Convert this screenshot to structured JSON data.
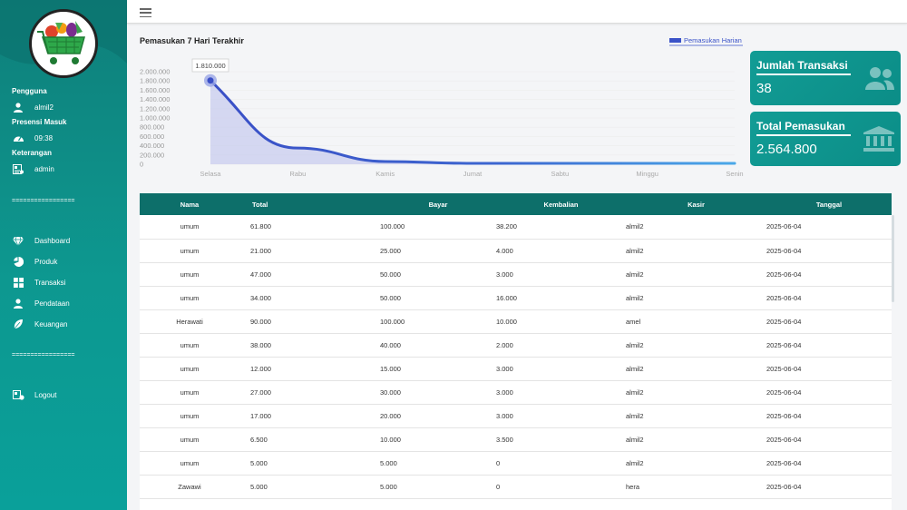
{
  "sidebar": {
    "pengguna_title": "Pengguna",
    "pengguna_value": "almil2",
    "presensi_title": "Presensi Masuk",
    "presensi_value": "09:38",
    "keterangan_title": "Keterangan",
    "keterangan_value": "admin",
    "divider": "=================",
    "menu": [
      {
        "label": "Dashboard",
        "icon": "gem-icon"
      },
      {
        "label": "Produk",
        "icon": "pie-icon"
      },
      {
        "label": "Transaksi",
        "icon": "grid-icon"
      },
      {
        "label": "Pendataan",
        "icon": "user-icon"
      },
      {
        "label": "Keuangan",
        "icon": "leaf-icon"
      }
    ],
    "logout": "Logout"
  },
  "chart": {
    "title": "Pemasukan 7 Hari Terakhir",
    "legend": "Pemasukan Harian",
    "tooltip": "1.810.000"
  },
  "chart_data": {
    "type": "area",
    "categories": [
      "Selasa",
      "Rabu",
      "Kamis",
      "Jumat",
      "Sabtu",
      "Minggu",
      "Senin"
    ],
    "series": [
      {
        "name": "Pemasukan Harian",
        "values": [
          1810000,
          350000,
          60000,
          20000,
          20000,
          20000,
          20000
        ]
      }
    ],
    "ylim": [
      0,
      2000000
    ],
    "yticks": [
      "0",
      "200.000",
      "400.000",
      "600.000",
      "800.000",
      "1.000.000",
      "1.200.000",
      "1.400.000",
      "1.600.000",
      "1.800.000",
      "2.000.000"
    ],
    "grid": true,
    "legend_position": "top-right",
    "colors": {
      "line": "#3a52c8",
      "fill": "#c6cbee"
    }
  },
  "cards": [
    {
      "title": "Jumlah Transaksi",
      "value": "38",
      "icon": "users-icon"
    },
    {
      "title": "Total Pemasukan",
      "value": "2.564.800",
      "icon": "bank-icon"
    }
  ],
  "table": {
    "headers": [
      "Nama",
      "Total",
      "Bayar",
      "Kembalian",
      "Kasir",
      "Tanggal"
    ],
    "rows": [
      [
        "umum",
        "61.800",
        "100.000",
        "38.200",
        "almil2",
        "2025-06-04"
      ],
      [
        "umum",
        "21.000",
        "25.000",
        "4.000",
        "almil2",
        "2025-06-04"
      ],
      [
        "umum",
        "47.000",
        "50.000",
        "3.000",
        "almil2",
        "2025-06-04"
      ],
      [
        "umum",
        "34.000",
        "50.000",
        "16.000",
        "almil2",
        "2025-06-04"
      ],
      [
        "Herawati",
        "90.000",
        "100.000",
        "10.000",
        "amel",
        "2025-06-04"
      ],
      [
        "umum",
        "38.000",
        "40.000",
        "2.000",
        "almil2",
        "2025-06-04"
      ],
      [
        "umum",
        "12.000",
        "15.000",
        "3.000",
        "almil2",
        "2025-06-04"
      ],
      [
        "umum",
        "27.000",
        "30.000",
        "3.000",
        "almil2",
        "2025-06-04"
      ],
      [
        "umum",
        "17.000",
        "20.000",
        "3.000",
        "almil2",
        "2025-06-04"
      ],
      [
        "umum",
        "6.500",
        "10.000",
        "3.500",
        "almil2",
        "2025-06-04"
      ],
      [
        "umum",
        "5.000",
        "5.000",
        "0",
        "almil2",
        "2025-06-04"
      ],
      [
        "Zawawi",
        "5.000",
        "5.000",
        "0",
        "hera",
        "2025-06-04"
      ]
    ]
  },
  "colors": {
    "sidebar": "#0d9890",
    "card": "#129c95",
    "table_header": "#0d6f6a"
  }
}
